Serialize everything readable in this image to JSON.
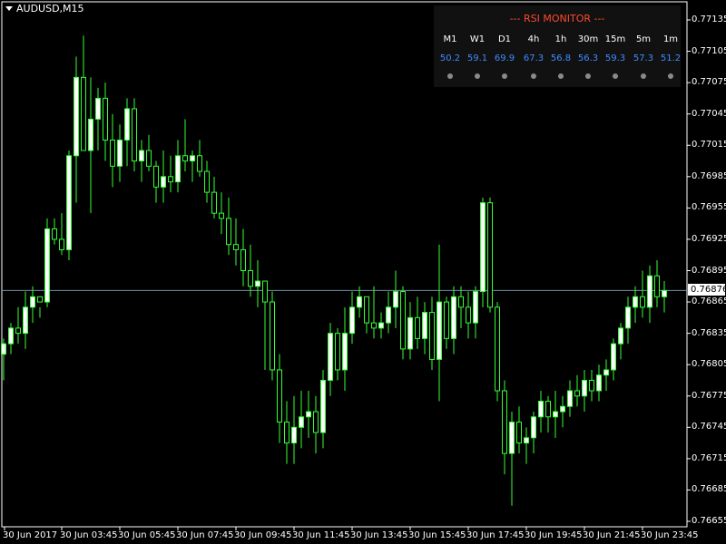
{
  "symbol": {
    "label": "AUDUSD,M15"
  },
  "rsi_monitor": {
    "title": "--- RSI MONITOR ---",
    "timeframes": [
      "M1",
      "W1",
      "D1",
      "4h",
      "1h",
      "30m",
      "15m",
      "5m",
      "1m"
    ],
    "values": [
      "50.2",
      "59.1",
      "69.9",
      "67.3",
      "56.8",
      "56.3",
      "59.3",
      "57.3",
      "51.2"
    ]
  },
  "price_axis": {
    "ticks": [
      "0.77135",
      "0.77105",
      "0.77075",
      "0.77045",
      "0.77015",
      "0.76985",
      "0.76955",
      "0.76925",
      "0.76895",
      "0.76865",
      "0.76835",
      "0.76805",
      "0.76775",
      "0.76745",
      "0.76715",
      "0.76685",
      "0.76655"
    ],
    "current_price": "0.76876"
  },
  "time_axis": {
    "labels": [
      "30 Jun 2017",
      "30 Jun 03:45",
      "30 Jun 05:45",
      "30 Jun 07:45",
      "30 Jun 09:45",
      "30 Jun 11:45",
      "30 Jun 13:45",
      "30 Jun 15:45",
      "30 Jun 17:45",
      "30 Jun 19:45",
      "30 Jun 21:45",
      "30 Jun 23:45"
    ]
  },
  "colors": {
    "bull": "#ffffff",
    "bear": "#000000",
    "wick": "#33ff33",
    "grid_line": "#6f8fa8"
  },
  "chart_data": {
    "type": "candlestick",
    "y_range": [
      0.7665,
      0.7715
    ],
    "candles": [
      [
        0.76815,
        0.7683,
        0.7679,
        0.76825
      ],
      [
        0.76825,
        0.76845,
        0.76815,
        0.7684
      ],
      [
        0.7684,
        0.7686,
        0.76825,
        0.76835
      ],
      [
        0.76835,
        0.76875,
        0.7682,
        0.7686
      ],
      [
        0.7686,
        0.7688,
        0.76845,
        0.7687
      ],
      [
        0.7687,
        0.7686,
        0.7685,
        0.76865
      ],
      [
        0.76865,
        0.76945,
        0.7686,
        0.76935
      ],
      [
        0.76935,
        0.76945,
        0.7692,
        0.76925
      ],
      [
        0.76925,
        0.7695,
        0.7691,
        0.76915
      ],
      [
        0.76915,
        0.7701,
        0.76905,
        0.77005
      ],
      [
        0.77005,
        0.771,
        0.7696,
        0.7708
      ],
      [
        0.7708,
        0.7712,
        0.7704,
        0.7701
      ],
      [
        0.7701,
        0.7708,
        0.7695,
        0.7704
      ],
      [
        0.7704,
        0.7707,
        0.7701,
        0.7706
      ],
      [
        0.7706,
        0.77075,
        0.77,
        0.7702
      ],
      [
        0.7702,
        0.77045,
        0.76975,
        0.76995
      ],
      [
        0.76995,
        0.77035,
        0.7698,
        0.7702
      ],
      [
        0.7702,
        0.7706,
        0.76995,
        0.7705
      ],
      [
        0.7705,
        0.7706,
        0.7699,
        0.77
      ],
      [
        0.77,
        0.7702,
        0.7698,
        0.7701
      ],
      [
        0.7701,
        0.77025,
        0.7699,
        0.76995
      ],
      [
        0.76995,
        0.77,
        0.7696,
        0.76975
      ],
      [
        0.76975,
        0.7701,
        0.7696,
        0.76985
      ],
      [
        0.76985,
        0.77005,
        0.7697,
        0.7698
      ],
      [
        0.7698,
        0.7702,
        0.7697,
        0.77005
      ],
      [
        0.77005,
        0.7704,
        0.7699,
        0.77
      ],
      [
        0.77,
        0.7701,
        0.7698,
        0.77005
      ],
      [
        0.77005,
        0.7702,
        0.76985,
        0.7699
      ],
      [
        0.7699,
        0.77,
        0.7696,
        0.7697
      ],
      [
        0.7697,
        0.76985,
        0.76945,
        0.7695
      ],
      [
        0.7695,
        0.7697,
        0.7693,
        0.76945
      ],
      [
        0.76945,
        0.76965,
        0.7691,
        0.7692
      ],
      [
        0.7692,
        0.76945,
        0.769,
        0.76915
      ],
      [
        0.76915,
        0.76935,
        0.7688,
        0.76895
      ],
      [
        0.76895,
        0.7692,
        0.7687,
        0.7688
      ],
      [
        0.7688,
        0.76905,
        0.7686,
        0.76885
      ],
      [
        0.76885,
        0.7688,
        0.768,
        0.76865
      ],
      [
        0.76865,
        0.76875,
        0.7679,
        0.768
      ],
      [
        0.768,
        0.76815,
        0.7673,
        0.7675
      ],
      [
        0.7675,
        0.7677,
        0.7671,
        0.7673
      ],
      [
        0.7673,
        0.76775,
        0.7671,
        0.76745
      ],
      [
        0.76745,
        0.7678,
        0.76725,
        0.76755
      ],
      [
        0.76755,
        0.7678,
        0.76735,
        0.7676
      ],
      [
        0.7676,
        0.76775,
        0.7672,
        0.7674
      ],
      [
        0.7674,
        0.768,
        0.76725,
        0.7679
      ],
      [
        0.7679,
        0.76845,
        0.76775,
        0.76835
      ],
      [
        0.76835,
        0.7684,
        0.7679,
        0.768
      ],
      [
        0.768,
        0.7686,
        0.7678,
        0.76835
      ],
      [
        0.76835,
        0.76875,
        0.76825,
        0.7686
      ],
      [
        0.7686,
        0.7688,
        0.7685,
        0.7687
      ],
      [
        0.7687,
        0.7687,
        0.76835,
        0.76845
      ],
      [
        0.76845,
        0.7688,
        0.7683,
        0.7684
      ],
      [
        0.7684,
        0.76855,
        0.7683,
        0.76845
      ],
      [
        0.76845,
        0.76875,
        0.76835,
        0.7686
      ],
      [
        0.7686,
        0.76895,
        0.7684,
        0.76875
      ],
      [
        0.76875,
        0.7688,
        0.7681,
        0.7682
      ],
      [
        0.7682,
        0.76865,
        0.7681,
        0.7685
      ],
      [
        0.7685,
        0.7687,
        0.7682,
        0.7683
      ],
      [
        0.7683,
        0.76865,
        0.76815,
        0.76855
      ],
      [
        0.76855,
        0.7687,
        0.768,
        0.7681
      ],
      [
        0.7681,
        0.7692,
        0.7677,
        0.76865
      ],
      [
        0.76865,
        0.7687,
        0.7682,
        0.7683
      ],
      [
        0.7683,
        0.7688,
        0.76815,
        0.7687
      ],
      [
        0.7687,
        0.7688,
        0.7684,
        0.7686
      ],
      [
        0.7686,
        0.76875,
        0.7683,
        0.76845
      ],
      [
        0.76845,
        0.7688,
        0.7683,
        0.76875
      ],
      [
        0.76875,
        0.76965,
        0.7686,
        0.7696
      ],
      [
        0.7696,
        0.76965,
        0.76855,
        0.7686
      ],
      [
        0.7686,
        0.76865,
        0.7677,
        0.7678
      ],
      [
        0.7678,
        0.7679,
        0.767,
        0.7672
      ],
      [
        0.7672,
        0.7676,
        0.7667,
        0.7675
      ],
      [
        0.7675,
        0.76765,
        0.7672,
        0.7673
      ],
      [
        0.7673,
        0.76745,
        0.7671,
        0.76735
      ],
      [
        0.76735,
        0.7676,
        0.7672,
        0.76755
      ],
      [
        0.76755,
        0.7678,
        0.7674,
        0.7677
      ],
      [
        0.7677,
        0.76775,
        0.7674,
        0.76755
      ],
      [
        0.76755,
        0.7678,
        0.76735,
        0.7676
      ],
      [
        0.7676,
        0.76775,
        0.76745,
        0.76765
      ],
      [
        0.76765,
        0.7679,
        0.76755,
        0.7678
      ],
      [
        0.7678,
        0.76795,
        0.76765,
        0.76775
      ],
      [
        0.76775,
        0.768,
        0.7676,
        0.7679
      ],
      [
        0.7679,
        0.768,
        0.7677,
        0.7678
      ],
      [
        0.7678,
        0.76805,
        0.7677,
        0.76795
      ],
      [
        0.76795,
        0.7681,
        0.7678,
        0.768
      ],
      [
        0.768,
        0.7683,
        0.7679,
        0.76825
      ],
      [
        0.76825,
        0.76845,
        0.7681,
        0.7684
      ],
      [
        0.7684,
        0.7687,
        0.76825,
        0.7686
      ],
      [
        0.7686,
        0.7688,
        0.76845,
        0.7687
      ],
      [
        0.7687,
        0.76895,
        0.7685,
        0.7686
      ],
      [
        0.7686,
        0.769,
        0.76845,
        0.7689
      ],
      [
        0.7689,
        0.76905,
        0.7686,
        0.7687
      ],
      [
        0.7687,
        0.76885,
        0.76855,
        0.76876
      ]
    ]
  }
}
